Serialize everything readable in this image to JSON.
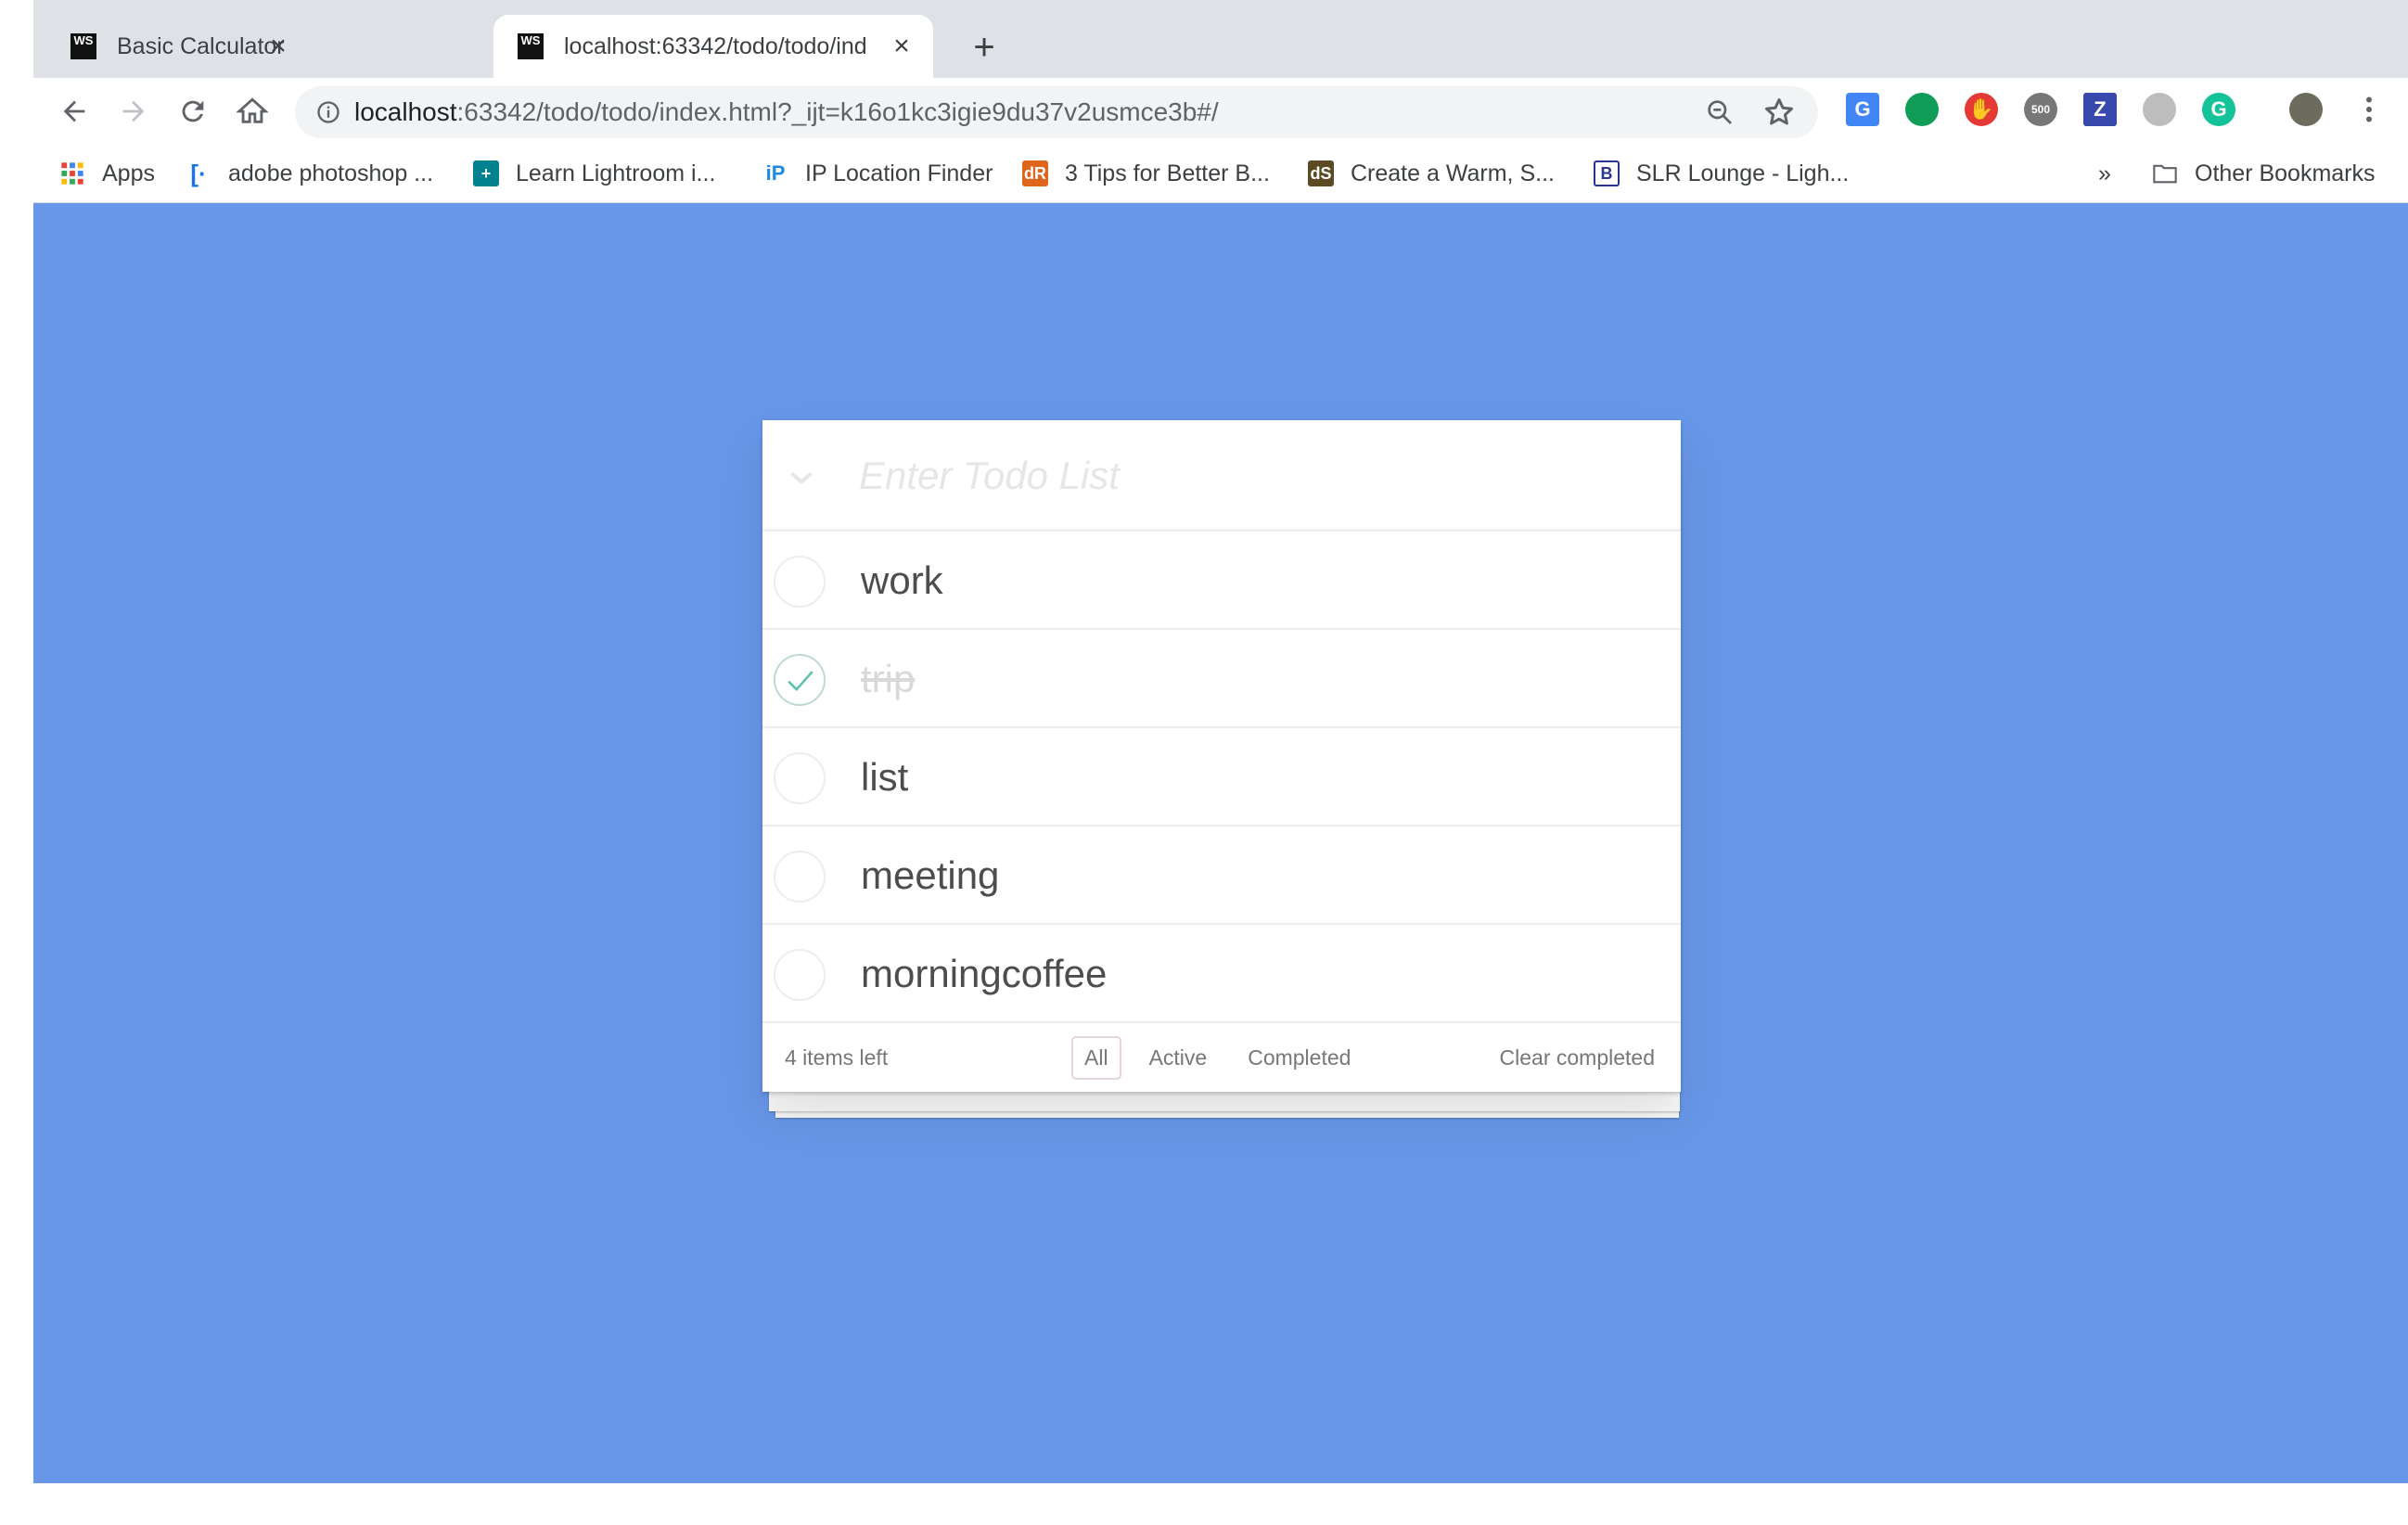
{
  "browser": {
    "tabs": [
      {
        "title": "Basic Calculator",
        "favicon": "WS",
        "active": false
      },
      {
        "title": "localhost:63342/todo/todo/ind",
        "favicon": "WS",
        "active": true
      }
    ],
    "address": {
      "host": "localhost",
      "path": ":63342/todo/todo/index.html?_ijt=k16o1kc3igie9du37v2usmce3b#/"
    },
    "bookmarks": [
      {
        "label": "Apps",
        "icon": "apps-grid-icon"
      },
      {
        "label": "adobe photoshop ...",
        "icon": "bracket-icon"
      },
      {
        "label": "Learn Lightroom i...",
        "icon": "plus-square-icon"
      },
      {
        "label": "IP Location Finder",
        "icon": "ip-icon"
      },
      {
        "label": "3 Tips for Better B...",
        "icon": "dr-icon"
      },
      {
        "label": "Create a Warm, S...",
        "icon": "ds-icon"
      },
      {
        "label": "SLR Lounge - Ligh...",
        "icon": "b-icon"
      }
    ],
    "overflow_label": "»",
    "other_bookmarks": "Other Bookmarks",
    "extensions": [
      {
        "name": "google-translate-icon",
        "color": "#4285f4"
      },
      {
        "name": "chat-bubble-icon",
        "color": "#0f9d58"
      },
      {
        "name": "stop-hand-icon",
        "color": "#e53935"
      },
      {
        "name": "500px-icon",
        "color": "#777777"
      },
      {
        "name": "z-icon",
        "color": "#3949ab"
      },
      {
        "name": "circle-icon",
        "color": "#bdbdbd"
      },
      {
        "name": "grammarly-icon",
        "color": "#15c39a"
      }
    ]
  },
  "todo": {
    "placeholder": "Enter Todo List",
    "items": [
      {
        "title": "work",
        "completed": false
      },
      {
        "title": "trip",
        "completed": true
      },
      {
        "title": "list",
        "completed": false
      },
      {
        "title": "meeting",
        "completed": false
      },
      {
        "title": "morningcoffee",
        "completed": false
      }
    ],
    "footer": {
      "count": "4 items left",
      "filters": [
        "All",
        "Active",
        "Completed"
      ],
      "selected_filter": "All",
      "clear": "Clear completed"
    }
  },
  "colors": {
    "page_bg": "#6897e9",
    "check_done": "#5dc2af"
  }
}
